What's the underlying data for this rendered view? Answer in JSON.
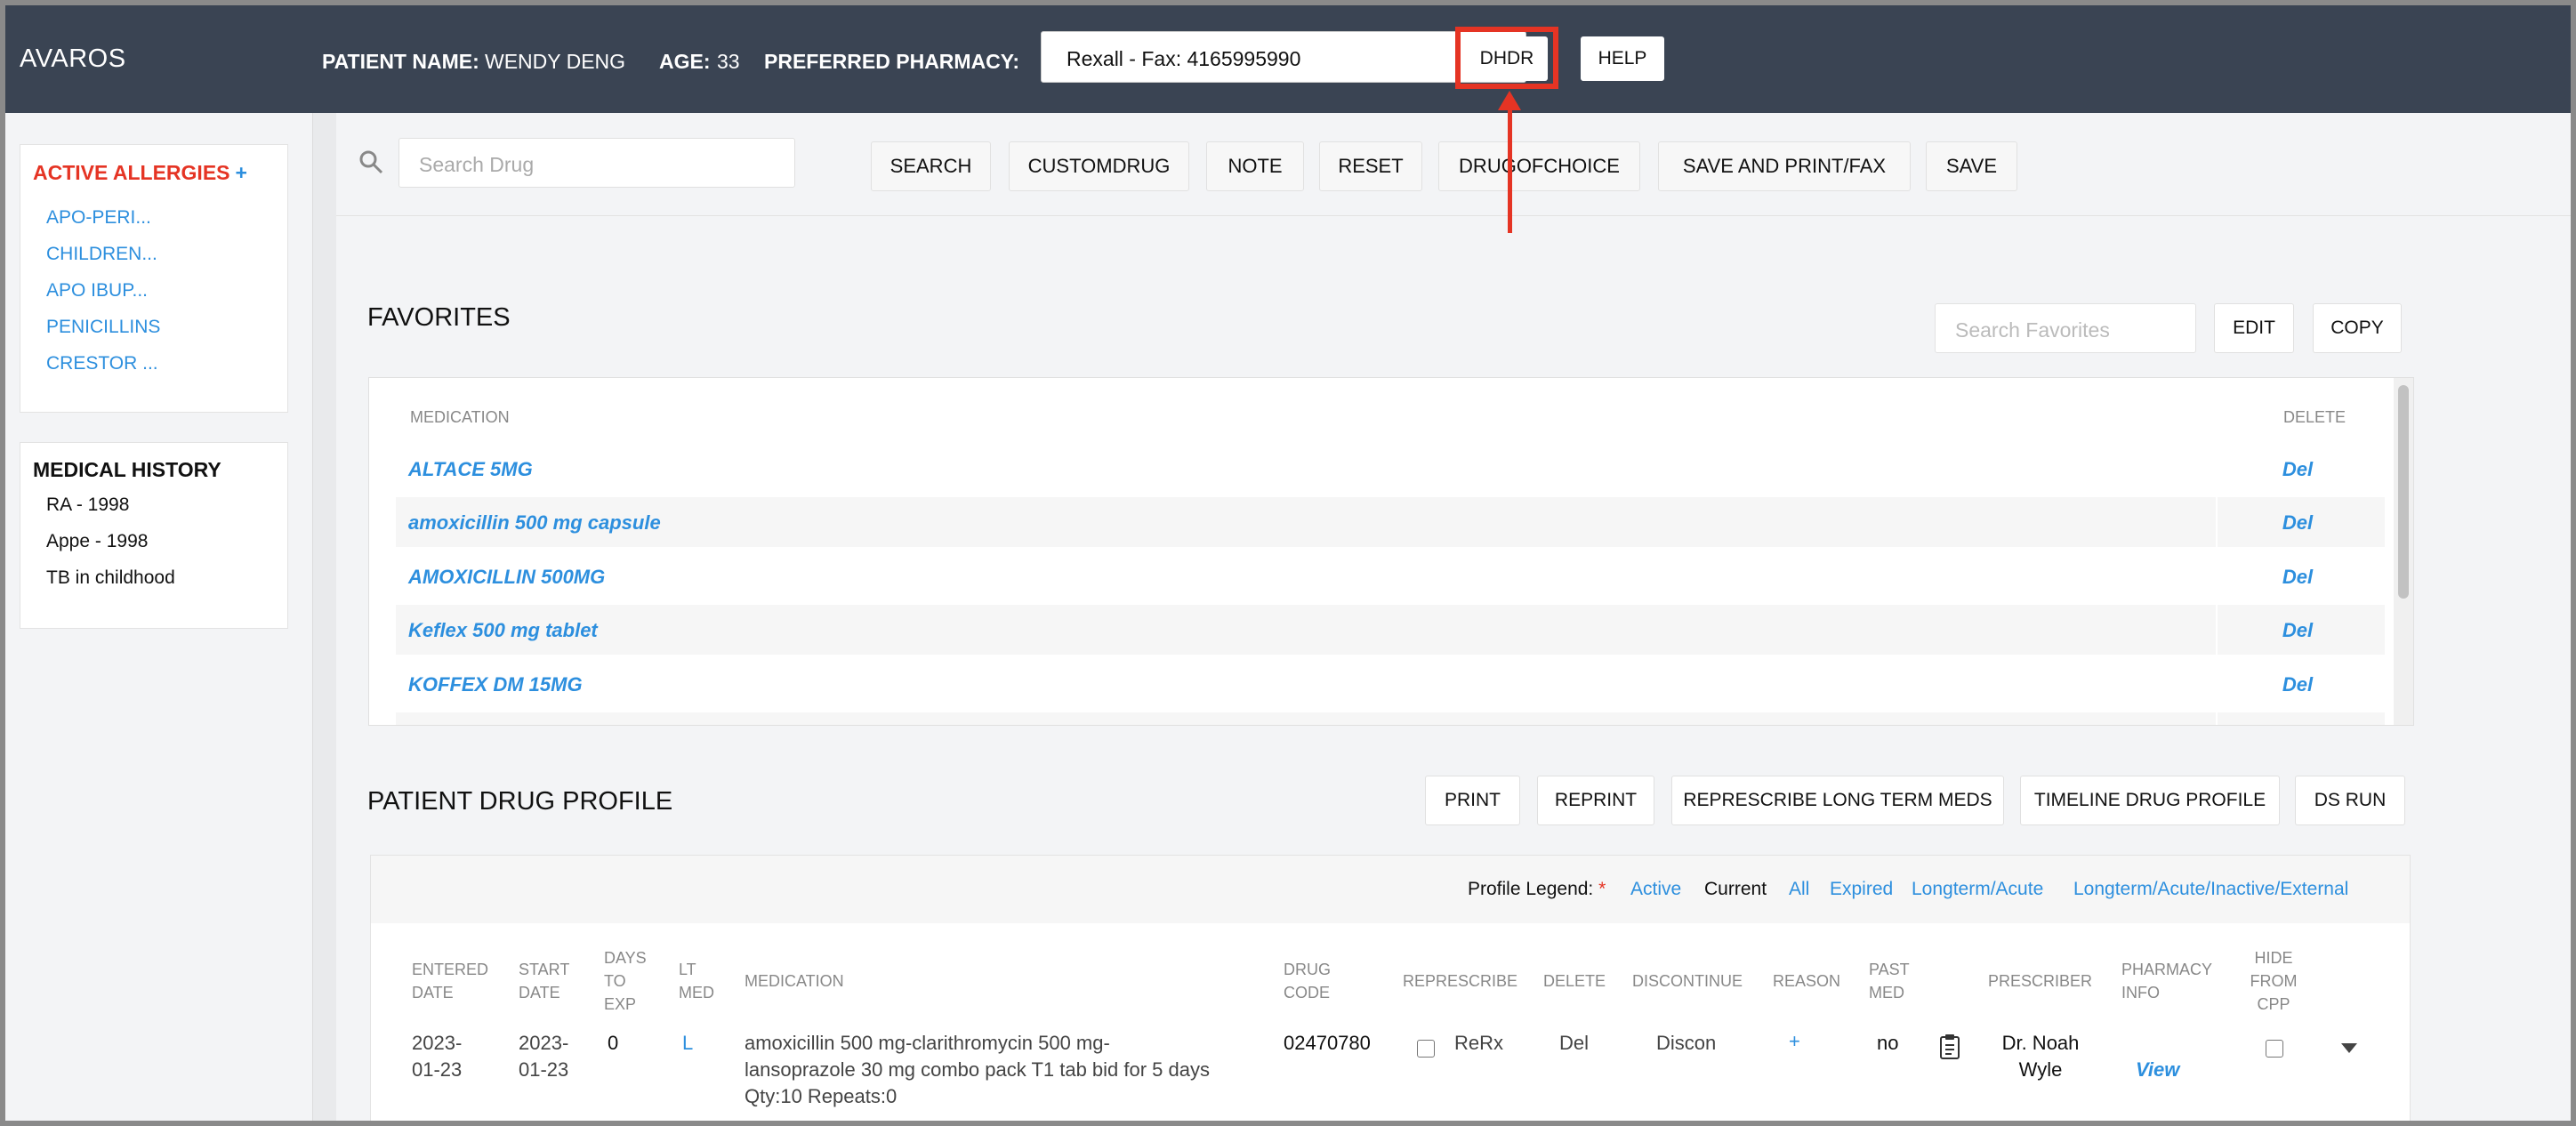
{
  "header": {
    "brand": "AVAROS",
    "patient_name_label": "PATIENT NAME:",
    "patient_name": "WENDY DENG",
    "age_label": "AGE:",
    "age": "33",
    "pharmacy_label": "PREFERRED PHARMACY:",
    "pharmacy_value": "Rexall - Fax: 4165995990",
    "dhdr_label": "DHDR",
    "help_label": "HELP"
  },
  "sidebar": {
    "allergies_title": "ACTIVE ALLERGIES",
    "allergies_add": "+",
    "allergies": [
      "APO-PERI...",
      "CHILDREN...",
      "APO IBUP...",
      "PENICILLINS",
      "CRESTOR ..."
    ],
    "history_title": "MEDICAL HISTORY",
    "history": [
      "RA - 1998",
      "Appe - 1998",
      "TB in childhood"
    ]
  },
  "toolbar": {
    "search_placeholder": "Search Drug",
    "buttons": [
      "SEARCH",
      "CUSTOMDRUG",
      "NOTE",
      "RESET",
      "DRUGOFCHOICE",
      "SAVE AND PRINT/FAX",
      "SAVE"
    ]
  },
  "favorites": {
    "title": "FAVORITES",
    "search_placeholder": "Search Favorites",
    "edit_label": "EDIT",
    "copy_label": "COPY",
    "col_medication": "MEDICATION",
    "col_delete": "DELETE",
    "rows": [
      {
        "medication": "ALTACE 5MG",
        "delete": "Del"
      },
      {
        "medication": "amoxicillin 500 mg capsule",
        "delete": "Del"
      },
      {
        "medication": "AMOXICILLIN 500MG",
        "delete": "Del"
      },
      {
        "medication": "Keflex 500 mg tablet",
        "delete": "Del"
      },
      {
        "medication": "KOFFEX DM 15MG",
        "delete": "Del"
      }
    ]
  },
  "profile": {
    "title": "PATIENT DRUG PROFILE",
    "buttons": [
      "PRINT",
      "REPRINT",
      "REPRESCRIBE LONG TERM MEDS",
      "TIMELINE DRUG PROFILE",
      "DS RUN"
    ],
    "legend_label": "Profile Legend:",
    "legend_star": "*",
    "legend_items": [
      "Active",
      "Current",
      "All",
      "Expired",
      "Longterm/Acute",
      "Longterm/Acute/Inactive/External"
    ],
    "columns": {
      "entered_1": "ENTERED",
      "entered_2": "DATE",
      "start_1": "START",
      "start_2": "DATE",
      "days_1": "DAYS",
      "days_2": "TO",
      "days_3": "EXP",
      "lt_1": "LT",
      "lt_2": "MED",
      "medication": "MEDICATION",
      "drug_code_1": "DRUG",
      "drug_code_2": "CODE",
      "represcribe": "REPRESCRIBE",
      "delete": "DELETE",
      "discontinue": "DISCONTINUE",
      "reason": "REASON",
      "past_1": "PAST",
      "past_2": "MED",
      "prescriber": "PRESCRIBER",
      "pharmacy_1": "PHARMACY",
      "pharmacy_2": "INFO",
      "hide_1": "HIDE",
      "hide_2": "FROM",
      "hide_3": "CPP"
    },
    "row": {
      "entered_1": "2023-",
      "entered_2": "01-23",
      "start_1": "2023-",
      "start_2": "01-23",
      "days": "0",
      "lt": "L",
      "med_1": "amoxicillin 500 mg-clarithromycin 500 mg-",
      "med_2": "lansoprazole 30 mg combo pack T1 tab bid for 5 days",
      "med_3": "Qty:10 Repeats:0",
      "drug_code": "02470780",
      "rerx": "ReRx",
      "del": "Del",
      "discon": "Discon",
      "reason": "+",
      "past": "no",
      "prescriber_1": "Dr. Noah",
      "prescriber_2": "Wyle",
      "view": "View"
    }
  },
  "colors": {
    "header_bg": "#3a4453",
    "link_blue": "#2d8fde",
    "allergy_red": "#e53424",
    "highlight_red": "#e53424"
  },
  "icons": [
    "search-icon",
    "chevron-down-icon",
    "clipboard-icon",
    "caret-down-icon",
    "arrow-up-icon"
  ]
}
